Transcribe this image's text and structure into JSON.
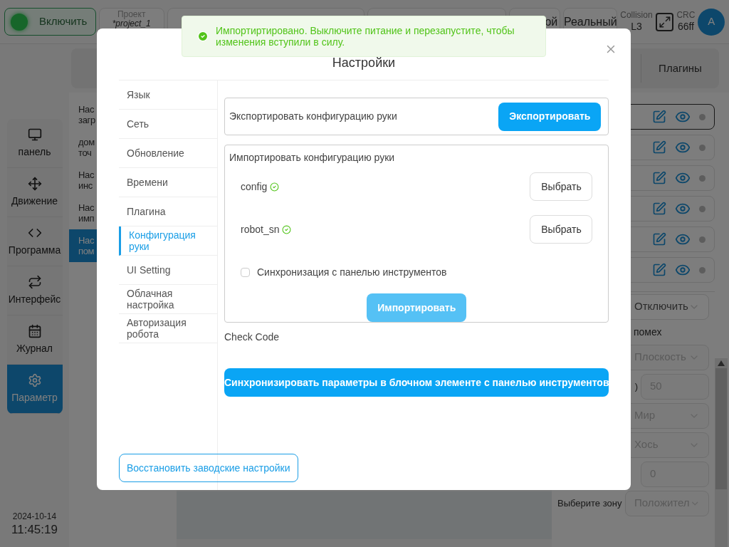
{
  "topbar": {
    "power": {
      "label": "Включить",
      "on": true
    },
    "project": {
      "label": "Проект",
      "value": "*project_1"
    },
    "mode_partial": "ой",
    "mode": "Реальный",
    "collision": {
      "label": "Collision",
      "value": "L3"
    },
    "crc": {
      "label": "CRC",
      "value": "66ff"
    },
    "avatar": "A"
  },
  "nav": [
    {
      "label": "панель",
      "selected": false
    },
    {
      "label": "Движение",
      "selected": false
    },
    {
      "label": "Программа",
      "selected": false
    },
    {
      "label": "Интерфейс",
      "selected": false
    },
    {
      "label": "Журнал",
      "selected": false
    },
    {
      "label": "Параметр",
      "selected": true
    }
  ],
  "datetime": {
    "date": "2024-10-14",
    "time": "11:45:19"
  },
  "sublist": [
    {
      "lines": [
        "Нас",
        "загр"
      ],
      "selected": false
    },
    {
      "lines": [
        "дом",
        "точ"
      ],
      "selected": false
    },
    {
      "lines": [
        "Нас",
        "инс"
      ],
      "selected": false
    },
    {
      "lines": [
        "Нас",
        "имп"
      ],
      "selected": false
    },
    {
      "lines": [
        "Нас",
        "пом"
      ],
      "selected": true
    }
  ],
  "right_panel": {
    "tab": "Плагины",
    "rows": [
      {
        "selected": true
      },
      {
        "selected": false
      },
      {
        "selected": false
      },
      {
        "selected": false
      },
      {
        "selected": false
      },
      {
        "selected": false
      }
    ],
    "fields": [
      {
        "kind": "select",
        "value": "Отключить",
        "disabled": false
      },
      {
        "kind": "label",
        "text": "помех"
      },
      {
        "kind": "select",
        "value": "Плоскость",
        "disabled": true
      },
      {
        "kind": "input",
        "label": ")",
        "value": "50",
        "disabled": true
      },
      {
        "kind": "select",
        "value": "Мир",
        "disabled": true
      },
      {
        "kind": "select",
        "value": "Хось",
        "disabled": true
      },
      {
        "kind": "input",
        "value": "0",
        "disabled": true
      },
      {
        "kind": "select",
        "label": "Выберите зону",
        "value": "Положител",
        "disabled": true
      }
    ]
  },
  "dialog": {
    "title": "Настройки",
    "menu": [
      {
        "label": "Язык",
        "selected": false
      },
      {
        "label": "Сеть",
        "selected": false
      },
      {
        "label": "Обновление",
        "selected": false
      },
      {
        "label": "Времени",
        "selected": false
      },
      {
        "label": "Плагина",
        "selected": false
      },
      {
        "label": "Конфигурация руки",
        "selected": true
      },
      {
        "label": "UI Setting",
        "selected": false
      },
      {
        "label": "Облачная настройка",
        "selected": false
      },
      {
        "label": "Авторизация робота",
        "selected": false
      }
    ],
    "export": {
      "label": "Экспортировать конфигурацию руки",
      "button": "Экспортировать"
    },
    "import": {
      "title": "Импортировать конфигурацию руки",
      "files": [
        {
          "name": "config",
          "valid": true,
          "button": "Выбрать"
        },
        {
          "name": "robot_sn",
          "valid": true,
          "button": "Выбрать"
        }
      ],
      "sync_checkbox": {
        "label": "Синхронизация с панелью инструментов",
        "checked": false
      },
      "button": "Импортировать"
    },
    "check_code": "Check Code",
    "sync_button": "Синхронизировать параметры в блочном элементе с панелью инструментов",
    "reset_button": "Восстановить заводские настройки"
  },
  "toast": {
    "text": "Импортиртировано. Выключите питание и перезапустите, чтобы изменения вступили в силу."
  }
}
